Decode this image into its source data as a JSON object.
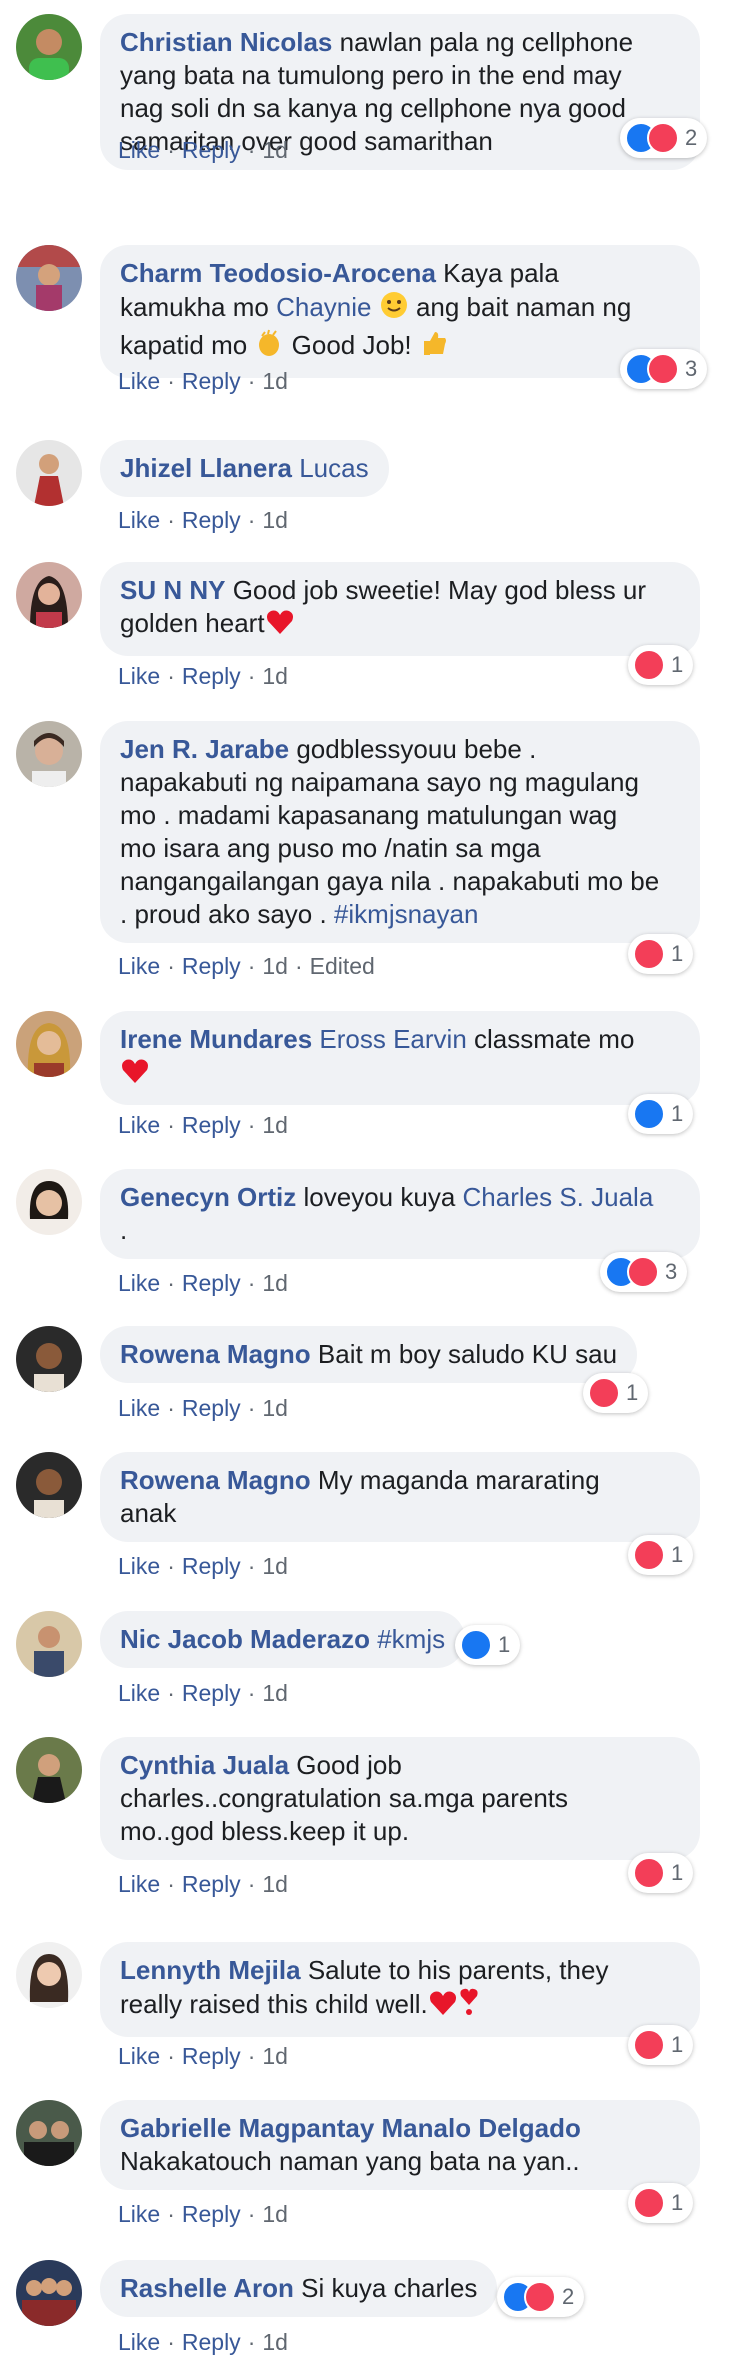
{
  "actions": {
    "like": "Like",
    "reply": "Reply",
    "edited": "Edited"
  },
  "colors": {
    "name": "#385898",
    "bubble": "#f0f2f5",
    "like_blue": "#1877f2",
    "love_red": "#f33e58"
  },
  "comments": [
    {
      "name": "Christian Nicolas",
      "lines": [
        "nawlan pala ng cellphone",
        "yang bata na tumulong pero in the end may",
        "nag soli dn sa kanya ng cellphone nya good",
        "samaritan over good samarithan"
      ],
      "time": "1d",
      "reactions": [
        "like-icon",
        "love-icon"
      ],
      "count": "2"
    },
    {
      "name": "Charm Teodosio-Arocena",
      "pre": "Kaya pala",
      "line2a": "kamukha mo",
      "mention": "Chaynie",
      "line2b": "ang bait naman ng",
      "line3a": "kapatid mo",
      "line3b": "Good Job!",
      "time": "1d",
      "reactions": [
        "like-icon",
        "love-icon"
      ],
      "count": "3"
    },
    {
      "name": "Jhizel Llanera",
      "mention": "Lucas",
      "time": "1d"
    },
    {
      "name": "SU N NY",
      "text1": "Good job sweetie! May god bless ur",
      "text2": "golden heart",
      "time": "1d",
      "reactions": [
        "love-icon"
      ],
      "count": "1"
    },
    {
      "name": "Jen R. Jarabe",
      "lines": [
        "godblessyouu bebe .",
        "napakabuti ng naipamana sayo ng magulang",
        "mo . madami kapasanang matulungan wag",
        "mo isara ang puso mo /natin sa mga",
        "nangangailangan gaya nila . napakabuti mo be"
      ],
      "last": ". proud ako sayo .",
      "tag": "#ikmjsnayan",
      "time": "1d",
      "edited": true,
      "reactions": [
        "love-icon"
      ],
      "count": "1"
    },
    {
      "name": "Irene Mundares",
      "mention": "Eross Earvin",
      "text1": "classmate mo",
      "time": "1d",
      "reactions": [
        "like-icon"
      ],
      "count": "1"
    },
    {
      "name": "Genecyn Ortiz",
      "text1": "loveyou kuya",
      "mention": "Charles S. Juala",
      "text2": ".",
      "time": "1d",
      "reactions": [
        "like-icon",
        "love-icon"
      ],
      "count": "3"
    },
    {
      "name": "Rowena Magno",
      "text1": "Bait m boy saludo KU sau",
      "time": "1d",
      "reactions": [
        "love-icon"
      ],
      "count": "1"
    },
    {
      "name": "Rowena Magno",
      "text1": "My maganda mararating",
      "text2": "anak",
      "time": "1d",
      "reactions": [
        "love-icon"
      ],
      "count": "1"
    },
    {
      "name": "Nic Jacob Maderazo",
      "tag": "#kmjs",
      "time": "1d",
      "reactions": [
        "like-icon"
      ],
      "count": "1"
    },
    {
      "name": "Cynthia Juala",
      "text1": "Good job",
      "lines": [
        "charles..congratulation sa.mga parents",
        "mo..god bless.keep it up."
      ],
      "time": "1d",
      "reactions": [
        "love-icon"
      ],
      "count": "1"
    },
    {
      "name": "Lennyth Mejila",
      "text1": "Salute to his parents, they",
      "text2": "really raised this child well.",
      "time": "1d",
      "reactions": [
        "love-icon"
      ],
      "count": "1"
    },
    {
      "name": "Gabrielle Magpantay Manalo Delgado",
      "text2": "Nakakatouch naman yang bata na yan..",
      "time": "1d",
      "reactions": [
        "love-icon"
      ],
      "count": "1"
    },
    {
      "name": "Rashelle Aron",
      "text1": "Si kuya charles",
      "time": "1d",
      "reactions": [
        "like-icon",
        "love-icon"
      ],
      "count": "2"
    }
  ]
}
